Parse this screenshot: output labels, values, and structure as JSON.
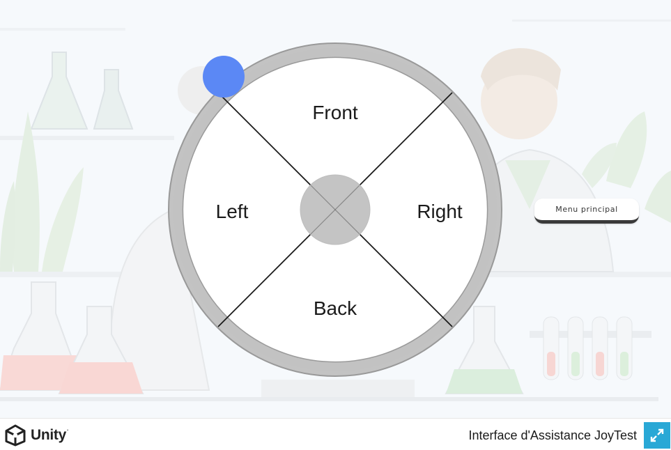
{
  "wheel": {
    "front_label": "Front",
    "left_label": "Left",
    "right_label": "Right",
    "back_label": "Back"
  },
  "menu": {
    "main_menu_label": "Menu principal"
  },
  "footer": {
    "brand": "Unity",
    "build_title": "Interface d'Assistance JoyTest",
    "fullscreen_icon": "fullscreen-icon"
  },
  "colors": {
    "cursor": "#5b88f5",
    "wheel_ring": "#c0c0c0",
    "wheel_center": "#c4c4c4",
    "fullscreen_button": "#29a8d6"
  }
}
